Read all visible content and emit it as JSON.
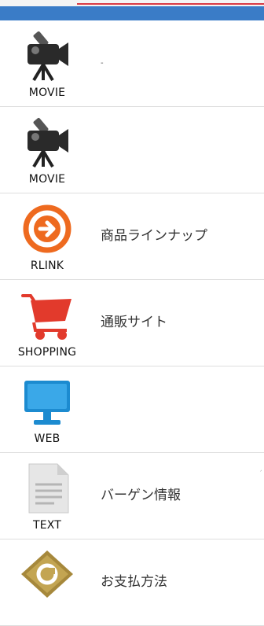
{
  "colors": {
    "topbar": "#3a7cc7",
    "accent_line": "#d93a44"
  },
  "menu": {
    "items": [
      {
        "icon": "movie-camera-icon",
        "caption": "MOVIE",
        "label": "-"
      },
      {
        "icon": "movie-camera-icon",
        "caption": "MOVIE",
        "label": ""
      },
      {
        "icon": "arrow-right-circle-icon",
        "caption": "RLINK",
        "label": "商品ラインナップ"
      },
      {
        "icon": "shopping-cart-icon",
        "caption": "SHOPPING",
        "label": "通販サイト"
      },
      {
        "icon": "monitor-icon",
        "caption": "WEB",
        "label": ""
      },
      {
        "icon": "document-icon",
        "caption": "TEXT",
        "label": "バーゲン情報"
      },
      {
        "icon": "coupon-icon",
        "caption": "",
        "label": "お支払方法"
      }
    ]
  }
}
